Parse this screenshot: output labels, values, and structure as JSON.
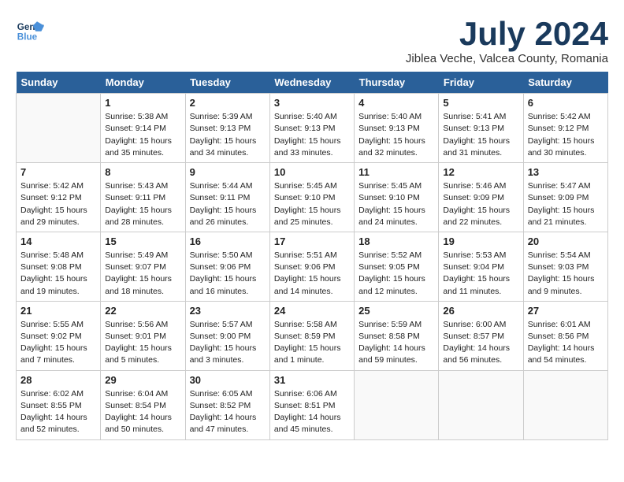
{
  "header": {
    "logo_line1": "General",
    "logo_line2": "Blue",
    "month_title": "July 2024",
    "subtitle": "Jiblea Veche, Valcea County, Romania"
  },
  "days_of_week": [
    "Sunday",
    "Monday",
    "Tuesday",
    "Wednesday",
    "Thursday",
    "Friday",
    "Saturday"
  ],
  "weeks": [
    [
      {
        "day": "",
        "sunrise": "",
        "sunset": "",
        "daylight": ""
      },
      {
        "day": "1",
        "sunrise": "Sunrise: 5:38 AM",
        "sunset": "Sunset: 9:14 PM",
        "daylight": "Daylight: 15 hours and 35 minutes."
      },
      {
        "day": "2",
        "sunrise": "Sunrise: 5:39 AM",
        "sunset": "Sunset: 9:13 PM",
        "daylight": "Daylight: 15 hours and 34 minutes."
      },
      {
        "day": "3",
        "sunrise": "Sunrise: 5:40 AM",
        "sunset": "Sunset: 9:13 PM",
        "daylight": "Daylight: 15 hours and 33 minutes."
      },
      {
        "day": "4",
        "sunrise": "Sunrise: 5:40 AM",
        "sunset": "Sunset: 9:13 PM",
        "daylight": "Daylight: 15 hours and 32 minutes."
      },
      {
        "day": "5",
        "sunrise": "Sunrise: 5:41 AM",
        "sunset": "Sunset: 9:13 PM",
        "daylight": "Daylight: 15 hours and 31 minutes."
      },
      {
        "day": "6",
        "sunrise": "Sunrise: 5:42 AM",
        "sunset": "Sunset: 9:12 PM",
        "daylight": "Daylight: 15 hours and 30 minutes."
      }
    ],
    [
      {
        "day": "7",
        "sunrise": "Sunrise: 5:42 AM",
        "sunset": "Sunset: 9:12 PM",
        "daylight": "Daylight: 15 hours and 29 minutes."
      },
      {
        "day": "8",
        "sunrise": "Sunrise: 5:43 AM",
        "sunset": "Sunset: 9:11 PM",
        "daylight": "Daylight: 15 hours and 28 minutes."
      },
      {
        "day": "9",
        "sunrise": "Sunrise: 5:44 AM",
        "sunset": "Sunset: 9:11 PM",
        "daylight": "Daylight: 15 hours and 26 minutes."
      },
      {
        "day": "10",
        "sunrise": "Sunrise: 5:45 AM",
        "sunset": "Sunset: 9:10 PM",
        "daylight": "Daylight: 15 hours and 25 minutes."
      },
      {
        "day": "11",
        "sunrise": "Sunrise: 5:45 AM",
        "sunset": "Sunset: 9:10 PM",
        "daylight": "Daylight: 15 hours and 24 minutes."
      },
      {
        "day": "12",
        "sunrise": "Sunrise: 5:46 AM",
        "sunset": "Sunset: 9:09 PM",
        "daylight": "Daylight: 15 hours and 22 minutes."
      },
      {
        "day": "13",
        "sunrise": "Sunrise: 5:47 AM",
        "sunset": "Sunset: 9:09 PM",
        "daylight": "Daylight: 15 hours and 21 minutes."
      }
    ],
    [
      {
        "day": "14",
        "sunrise": "Sunrise: 5:48 AM",
        "sunset": "Sunset: 9:08 PM",
        "daylight": "Daylight: 15 hours and 19 minutes."
      },
      {
        "day": "15",
        "sunrise": "Sunrise: 5:49 AM",
        "sunset": "Sunset: 9:07 PM",
        "daylight": "Daylight: 15 hours and 18 minutes."
      },
      {
        "day": "16",
        "sunrise": "Sunrise: 5:50 AM",
        "sunset": "Sunset: 9:06 PM",
        "daylight": "Daylight: 15 hours and 16 minutes."
      },
      {
        "day": "17",
        "sunrise": "Sunrise: 5:51 AM",
        "sunset": "Sunset: 9:06 PM",
        "daylight": "Daylight: 15 hours and 14 minutes."
      },
      {
        "day": "18",
        "sunrise": "Sunrise: 5:52 AM",
        "sunset": "Sunset: 9:05 PM",
        "daylight": "Daylight: 15 hours and 12 minutes."
      },
      {
        "day": "19",
        "sunrise": "Sunrise: 5:53 AM",
        "sunset": "Sunset: 9:04 PM",
        "daylight": "Daylight: 15 hours and 11 minutes."
      },
      {
        "day": "20",
        "sunrise": "Sunrise: 5:54 AM",
        "sunset": "Sunset: 9:03 PM",
        "daylight": "Daylight: 15 hours and 9 minutes."
      }
    ],
    [
      {
        "day": "21",
        "sunrise": "Sunrise: 5:55 AM",
        "sunset": "Sunset: 9:02 PM",
        "daylight": "Daylight: 15 hours and 7 minutes."
      },
      {
        "day": "22",
        "sunrise": "Sunrise: 5:56 AM",
        "sunset": "Sunset: 9:01 PM",
        "daylight": "Daylight: 15 hours and 5 minutes."
      },
      {
        "day": "23",
        "sunrise": "Sunrise: 5:57 AM",
        "sunset": "Sunset: 9:00 PM",
        "daylight": "Daylight: 15 hours and 3 minutes."
      },
      {
        "day": "24",
        "sunrise": "Sunrise: 5:58 AM",
        "sunset": "Sunset: 8:59 PM",
        "daylight": "Daylight: 15 hours and 1 minute."
      },
      {
        "day": "25",
        "sunrise": "Sunrise: 5:59 AM",
        "sunset": "Sunset: 8:58 PM",
        "daylight": "Daylight: 14 hours and 59 minutes."
      },
      {
        "day": "26",
        "sunrise": "Sunrise: 6:00 AM",
        "sunset": "Sunset: 8:57 PM",
        "daylight": "Daylight: 14 hours and 56 minutes."
      },
      {
        "day": "27",
        "sunrise": "Sunrise: 6:01 AM",
        "sunset": "Sunset: 8:56 PM",
        "daylight": "Daylight: 14 hours and 54 minutes."
      }
    ],
    [
      {
        "day": "28",
        "sunrise": "Sunrise: 6:02 AM",
        "sunset": "Sunset: 8:55 PM",
        "daylight": "Daylight: 14 hours and 52 minutes."
      },
      {
        "day": "29",
        "sunrise": "Sunrise: 6:04 AM",
        "sunset": "Sunset: 8:54 PM",
        "daylight": "Daylight: 14 hours and 50 minutes."
      },
      {
        "day": "30",
        "sunrise": "Sunrise: 6:05 AM",
        "sunset": "Sunset: 8:52 PM",
        "daylight": "Daylight: 14 hours and 47 minutes."
      },
      {
        "day": "31",
        "sunrise": "Sunrise: 6:06 AM",
        "sunset": "Sunset: 8:51 PM",
        "daylight": "Daylight: 14 hours and 45 minutes."
      },
      {
        "day": "",
        "sunrise": "",
        "sunset": "",
        "daylight": ""
      },
      {
        "day": "",
        "sunrise": "",
        "sunset": "",
        "daylight": ""
      },
      {
        "day": "",
        "sunrise": "",
        "sunset": "",
        "daylight": ""
      }
    ]
  ]
}
